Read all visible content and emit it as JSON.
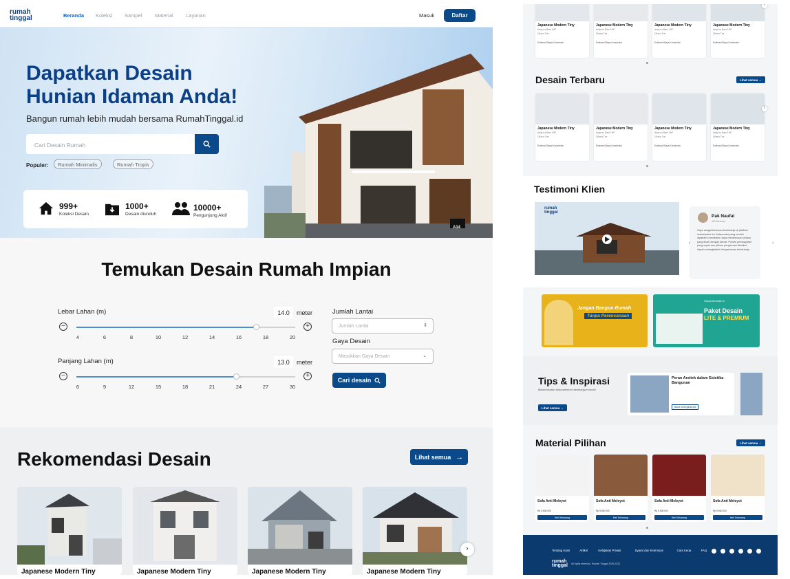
{
  "nav": {
    "logo_line1": "rumah",
    "logo_line2": "tinggal",
    "links": [
      "Beranda",
      "Koleksi",
      "Sampel",
      "Material",
      "Layanan"
    ],
    "login": "Masuk",
    "register": "Daftar"
  },
  "hero": {
    "title_line1": "Dapatkan Desain",
    "title_line2": "Hunian Idaman Anda!",
    "subtitle": "Bangun rumah lebih mudah bersama RumahTinggal.id",
    "search_placeholder": "Cari Desain Rumah",
    "popular_label": "Populer:",
    "popular": [
      "Rumah Minimalis",
      "Rumah Tropis"
    ],
    "stats": [
      {
        "num": "999+",
        "label": "Koleksi Desain"
      },
      {
        "num": "1000+",
        "label": "Desain diunduh"
      },
      {
        "num": "10000+",
        "label": "Pengunjung Aktif"
      }
    ],
    "image_tag": "A14"
  },
  "finder": {
    "title": "Temukan Desain Rumah Impian",
    "width_label": "Lebar Lahan (m)",
    "width_value": "14.0",
    "width_unit": "meter",
    "width_ticks": [
      "4",
      "6",
      "8",
      "10",
      "12",
      "14",
      "16",
      "18",
      "20"
    ],
    "width_level": 0.82,
    "length_label": "Panjang Lahan (m)",
    "length_value": "13.0",
    "length_unit": "meter",
    "length_ticks": [
      "6",
      "9",
      "12",
      "15",
      "18",
      "21",
      "24",
      "27",
      "30"
    ],
    "length_level": 0.73,
    "floors_label": "Jumlah Lantai",
    "floors_placeholder": "Jumlah Lantai",
    "style_label": "Gaya Desain",
    "style_placeholder": "Masukkan Gaya Desain",
    "search_btn": "Cari desain"
  },
  "recommend": {
    "title": "Rekomendasi Desain",
    "see_all": "Lihat semua",
    "cards": [
      "Japanese Modern Tiny",
      "Japanese Modern Tiny",
      "Japanese Modern Tiny",
      "Japanese Modern Tiny"
    ]
  },
  "right": {
    "card_title": "Japanese Modern Tiny",
    "card_sub": "Arsip no Barn 1HP",
    "card_dim": "10 m x 7 m",
    "card_cost": "Estimasi Biaya Konstruksi",
    "latest_title": "Desain Terbaru",
    "see_all": "Lihat semua",
    "testimoni_title": "Testimoni Klien",
    "testimoni_name": "Pak Naufal",
    "testimoni_role": "VIII Benzena",
    "testimoni_text": "Saya sangat terkesan berbelanja di platform marketplace ini. Antarmuka yang mudah dipahami membantu saya menemukan produk yang dicari dengan lancar. Proses pembayaran yang cepat dan pilihan pengiriman fleksibel dapat meningkatkan kenyamanan berbelanja.",
    "banner1_line1": "Jangan Bangun Rumah",
    "banner1_line2": "Tanpa Perencanaan",
    "banner2_small": "Hanya tersedia di",
    "banner2_line1": "Paket Desain",
    "banner2_line2": "LITE & PREMIUM",
    "tips_title": "Tips & Inspirasi",
    "tips_sub": "Bahan bacaan Anda sebelum membangun rumah",
    "tips_article_title": "Peran Arsitek dalam Estetika Bangunan",
    "tips_read": "Baca selengkapnya",
    "material_title": "Material Pilihan",
    "material_name": "Sofa Anti Meleyot",
    "material_price": "Rp 5.500.000",
    "material_btn": "Beli Sekarang",
    "footer_links": [
      "Tentang Kami",
      "Artikel",
      "Kebijakan Privasi",
      "Syarat dan Ketentuan",
      "Cara Kerja",
      "FAQ"
    ],
    "footer_copy": "All rights reserved. Rumah Tinggal 2020-2022"
  },
  "colors": {
    "primary": "#0b4a8a",
    "title_blue": "#0b3f86",
    "footer": "#0b3a6e",
    "banner_yellow": "#e8b21a",
    "banner_teal": "#1fa592"
  }
}
